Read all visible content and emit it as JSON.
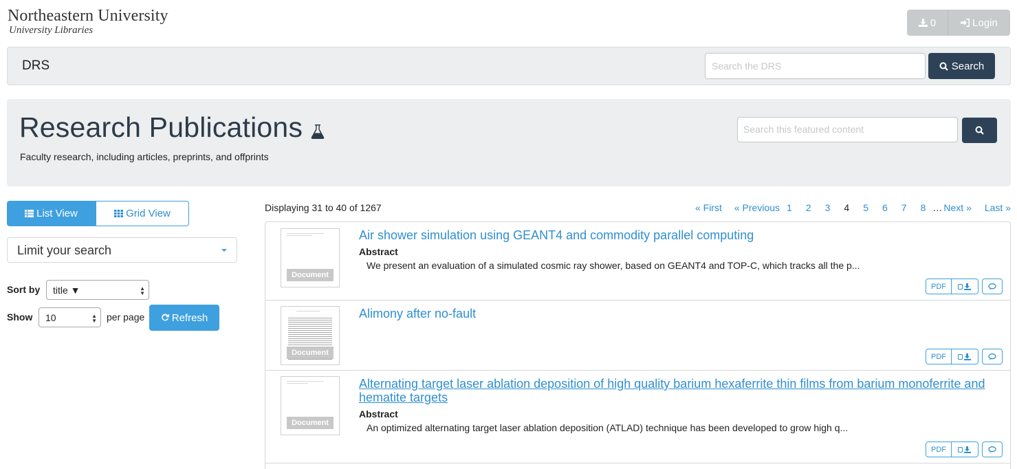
{
  "header": {
    "brand_name": "Northeastern University",
    "brand_sub": "University Libraries",
    "cart_count": "0",
    "login_label": "Login"
  },
  "navbar": {
    "title": "DRS",
    "search_placeholder": "Search the DRS",
    "search_button": "Search"
  },
  "hero": {
    "title": "Research Publications",
    "subtitle": "Faculty research, including articles, preprints, and offprints",
    "search_placeholder": "Search this featured content"
  },
  "sidebar": {
    "list_view": "List View",
    "grid_view": "Grid View",
    "limit_label": "Limit your search",
    "sort_label": "Sort by",
    "sort_value": "title ▼",
    "show_label": "Show",
    "show_value": "10",
    "per_page": "per page",
    "refresh": "Refresh"
  },
  "results": {
    "displaying": "Displaying 31 to 40 of 1267",
    "pager": {
      "first": "« First",
      "previous": "« Previous",
      "pages": [
        "1",
        "2",
        "3",
        "4",
        "5",
        "6",
        "7",
        "8"
      ],
      "current": "4",
      "ellipsis": "…",
      "next": "Next »",
      "last": "Last »"
    },
    "thumb_label": "Document",
    "abstract_label": "Abstract",
    "pdf_label": "PDF",
    "items": [
      {
        "title": "Air shower simulation using GEANT4 and commodity parallel computing",
        "abstract": "We present an evaluation of a simulated cosmic ray shower, based on GEANT4 and TOP-C, which tracks all the p..."
      },
      {
        "title": "Alimony after no-fault",
        "abstract": ""
      },
      {
        "title": "Alternating target laser ablation deposition of high quality barium hexaferrite thin films from barium monoferrite and hematite targets",
        "abstract": "An optimized alternating target laser ablation deposition (ATLAD) technique has been developed to grow high q..."
      }
    ]
  },
  "icons": {
    "download": "download-icon",
    "login": "sign-in-icon",
    "search": "search-icon",
    "flask": "flask-icon",
    "list": "list-icon",
    "grid": "grid-icon",
    "refresh": "refresh-icon",
    "comment": "comment-icon"
  },
  "colors": {
    "accent": "#3ea0de",
    "dark_button": "#2d4257",
    "panel": "#eceeef",
    "link": "#2f8fd0"
  }
}
